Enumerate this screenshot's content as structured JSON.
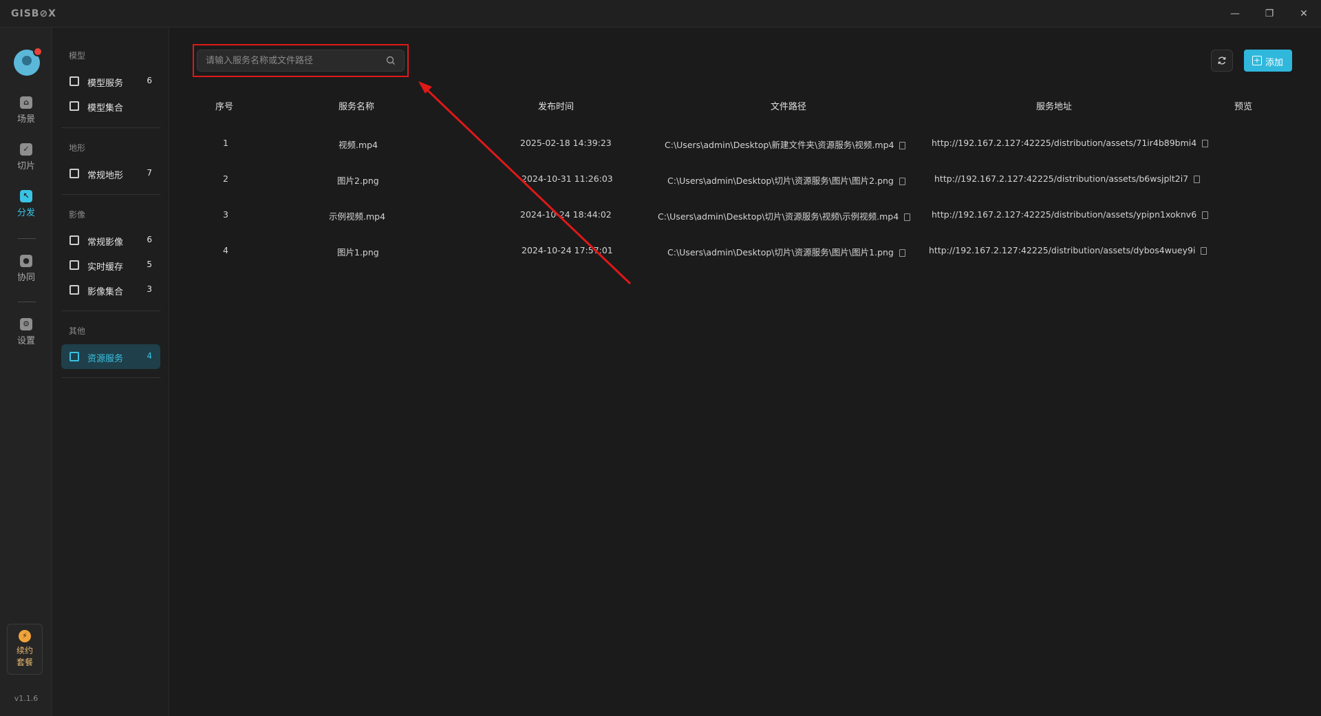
{
  "app": {
    "logo": "GISB⊘X"
  },
  "window": {
    "min": "—",
    "max": "❐",
    "close": "✕"
  },
  "rail": {
    "items": [
      {
        "label": "场景",
        "icon": "home-icon",
        "glyph": "⌂"
      },
      {
        "label": "切片",
        "icon": "slice-icon",
        "glyph": "✓"
      },
      {
        "label": "分发",
        "icon": "distribute-icon",
        "glyph": "↖"
      },
      {
        "label": "协同",
        "icon": "collab-icon",
        "glyph": "●"
      },
      {
        "label": "设置",
        "icon": "gear-icon",
        "glyph": "⚙"
      }
    ],
    "promo": {
      "line1": "续约",
      "line2": "套餐",
      "glyph": "⚡"
    },
    "version": "v1.1.6"
  },
  "categories": {
    "groups": [
      {
        "title": "模型",
        "items": [
          {
            "label": "模型服务",
            "count": "6"
          },
          {
            "label": "模型集合",
            "count": ""
          }
        ]
      },
      {
        "title": "地形",
        "items": [
          {
            "label": "常规地形",
            "count": "7"
          }
        ]
      },
      {
        "title": "影像",
        "items": [
          {
            "label": "常规影像",
            "count": "6"
          },
          {
            "label": "实时缓存",
            "count": "5"
          },
          {
            "label": "影像集合",
            "count": "3"
          }
        ]
      },
      {
        "title": "其他",
        "items": [
          {
            "label": "资源服务",
            "count": "4"
          }
        ]
      }
    ]
  },
  "search": {
    "placeholder": "请输入服务名称或文件路径",
    "value": ""
  },
  "toolbar": {
    "add_label": "添加"
  },
  "table": {
    "columns": [
      "序号",
      "服务名称",
      "发布时间",
      "文件路径",
      "服务地址",
      "预览"
    ],
    "rows": [
      {
        "index": "1",
        "name": "视频.mp4",
        "time": "2025-02-18 14:39:23",
        "path": "C:\\Users\\admin\\Desktop\\新建文件夹\\资源服务\\视频.mp4",
        "url": "http://192.167.2.127:42225/distribution/assets/71ir4b89bmi4"
      },
      {
        "index": "2",
        "name": "图片2.png",
        "time": "2024-10-31 11:26:03",
        "path": "C:\\Users\\admin\\Desktop\\切片\\资源服务\\图片\\图片2.png",
        "url": "http://192.167.2.127:42225/distribution/assets/b6wsjplt2i7"
      },
      {
        "index": "3",
        "name": "示例视频.mp4",
        "time": "2024-10-24 18:44:02",
        "path": "C:\\Users\\admin\\Desktop\\切片\\资源服务\\视频\\示例视频.mp4",
        "url": "http://192.167.2.127:42225/distribution/assets/ypipn1xoknv6"
      },
      {
        "index": "4",
        "name": "图片1.png",
        "time": "2024-10-24 17:57:01",
        "path": "C:\\Users\\admin\\Desktop\\切片\\资源服务\\图片\\图片1.png",
        "url": "http://192.167.2.127:42225/distribution/assets/dybos4wuey9i"
      }
    ]
  },
  "colors": {
    "accent": "#39c3e4",
    "annotation": "#e01818"
  }
}
